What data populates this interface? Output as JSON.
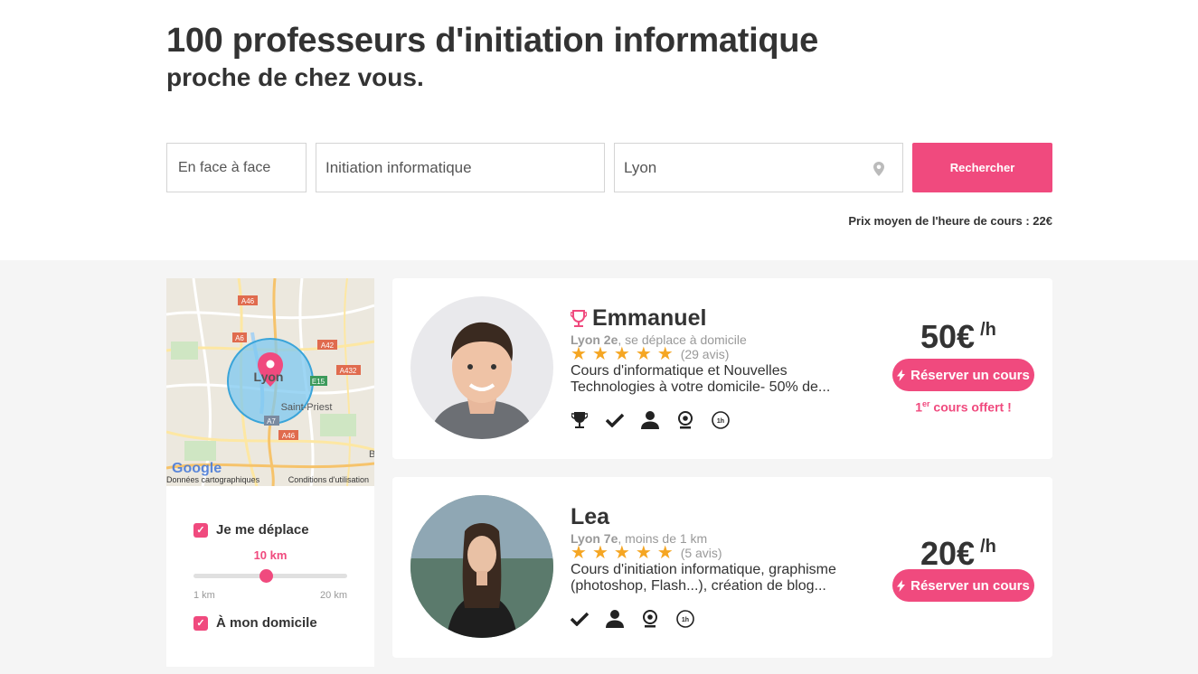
{
  "header": {
    "title": "100 professeurs d'initiation informatique",
    "subtitle": "proche de chez vous."
  },
  "search": {
    "mode_value": "En face à face",
    "subject_value": "Initiation informatique",
    "location_value": "Lyon",
    "button_label": "Rechercher",
    "average_price": "Prix moyen de l'heure de cours : 22€"
  },
  "map": {
    "labels": {
      "a46_top": "A46",
      "a6": "A6",
      "a42": "A42",
      "a432": "A432",
      "e15": "E15",
      "a7": "A7",
      "a46_bottom": "A46",
      "city": "Lyon",
      "saint_priest": "Saint-Priest",
      "edge_letter": "B"
    },
    "google": "Google",
    "credit_data": "Données cartographiques",
    "credit_terms": "Conditions d'utilisation"
  },
  "filters": {
    "travel_label": "Je me déplace",
    "travel_checked": true,
    "distance_value": "10 km",
    "distance_fraction": 0.47,
    "min_label": "1 km",
    "max_label": "20 km",
    "home_label": "À mon domicile",
    "home_checked": true
  },
  "teachers": [
    {
      "name": "Emmanuel",
      "location": "Lyon 2e",
      "mobility": ", se déplace à domicile",
      "rating": 5,
      "reviews": "(29 avis)",
      "description": "Cours d'informatique et Nouvelles Technologies à votre domicile- 50% de...",
      "price": "50€",
      "unit": "/h",
      "book_label": "Réserver un cours",
      "offer_sup": "er",
      "offer_first": "1",
      "offer_rest": " cours offert !",
      "icons": [
        "trophy-icon",
        "check-icon",
        "person-icon",
        "webcam-icon",
        "one-hour-icon"
      ]
    },
    {
      "name": "Lea",
      "location": "Lyon 7e",
      "mobility": ", moins de 1 km",
      "rating": 5,
      "reviews": "(5 avis)",
      "description": "Cours d'initiation informatique, graphisme (photoshop, Flash...), création de blog...",
      "price": "20€",
      "unit": "/h",
      "book_label": "Réserver un cours",
      "icons": [
        "check-icon",
        "person-icon",
        "webcam-icon",
        "one-hour-icon"
      ]
    }
  ],
  "colors": {
    "accent": "#f04a7e",
    "star": "#f5a623",
    "background": "#f5f5f5"
  }
}
